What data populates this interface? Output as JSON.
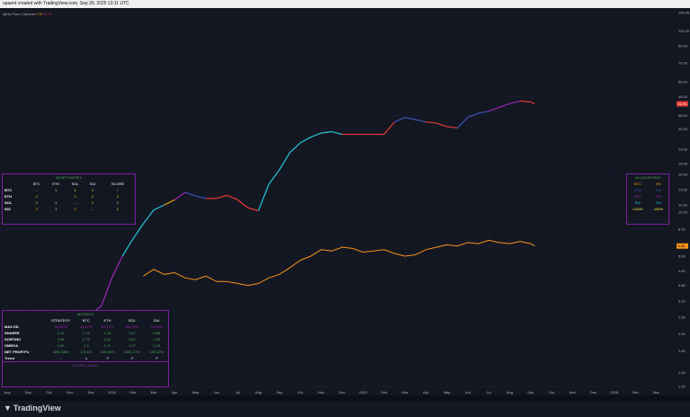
{
  "header": {
    "title": "opaent created with TradingView.com, Sep 29, 2025 13:11 UTC"
  },
  "legend": {
    "label": "Ajeto Flow | Opaent",
    "v1": "0.76",
    "v2": "41.91"
  },
  "price_tags": {
    "top": "41.91",
    "bottom": "6.40"
  },
  "footer": {
    "brand": "TradingView"
  },
  "asset_matrix": {
    "title": "ASSET MATRIX",
    "columns": [
      "",
      "BTC",
      "ETH",
      "SOL",
      "SUI",
      "SCORE"
    ],
    "rows": [
      {
        "label": "BTC",
        "cells": [
          "—",
          "1",
          "1",
          "1",
          "3"
        ]
      },
      {
        "label": "ETH",
        "cells": [
          "0",
          "—",
          "0",
          "0",
          "0"
        ]
      },
      {
        "label": "SOL",
        "cells": [
          "0",
          "1",
          "—",
          "0",
          "1"
        ]
      },
      {
        "label": "SUI",
        "cells": [
          "0",
          "1",
          "0",
          "—",
          "1"
        ]
      }
    ]
  },
  "allocations": {
    "title": "ALLOCATIONS",
    "rows": [
      {
        "label": "BTC",
        "value": "0%"
      },
      {
        "label": "ETH",
        "value": "0%"
      },
      {
        "label": "SOL",
        "value": "0%"
      },
      {
        "label": "SUI",
        "value": "0%"
      },
      {
        "label": "CASH",
        "value": "100%"
      }
    ]
  },
  "metrics": {
    "title": "METRICS",
    "columns": [
      "",
      "STRATEGY",
      "BTC",
      "ETH",
      "SOL",
      "SUI"
    ],
    "rows": [
      {
        "label": "MAX DD",
        "cells": [
          "32.82%",
          "26.17%",
          "63.77%",
          "58.79%",
          "76.24%"
        ]
      },
      {
        "label": "SHARPE",
        "cells": [
          "2.12",
          "1.72",
          "1.03",
          "1.67",
          "0.85"
        ]
      },
      {
        "label": "SORTINO",
        "cells": [
          "3.98",
          "2.75",
          "1.61",
          "3.07",
          "1.63"
        ]
      },
      {
        "label": "OMEGA",
        "cells": [
          "1.53",
          "1.3",
          "1.17",
          "1.27",
          "1.15"
        ]
      },
      {
        "label": "NET PROFIT%",
        "cells": [
          "4090.68%",
          "175.5%",
          "245.56%",
          "2051.27%",
          "133.22%"
        ]
      },
      {
        "label": "Trend",
        "cells": [
          "-",
          "↘",
          "↗",
          "↗",
          "↗"
        ]
      }
    ],
    "footer": "FILTER | Score"
  },
  "chart_data": {
    "type": "line",
    "y_scale": "log",
    "ylim": [
      1.0,
      140.0
    ],
    "yticks": [
      "140.00",
      "110.00",
      "90.00",
      "72.00",
      "56.00",
      "46.00",
      "36.00",
      "30.00",
      "23.00",
      "19.00",
      "16.50",
      "13.50",
      "11.00",
      "10.00",
      "8.00",
      "6.40",
      "5.60",
      "4.60",
      "3.80",
      "3.10",
      "2.50",
      "2.00",
      "1.60",
      "1.20",
      "1.00"
    ],
    "x_labels": [
      "Aug",
      "Sep",
      "Oct",
      "Nov",
      "Dec",
      "2024",
      "Feb",
      "Mar",
      "Apr",
      "May",
      "Jun",
      "Jul",
      "Aug",
      "Sep",
      "Oct",
      "Nov",
      "Dec",
      "2025",
      "Feb",
      "Mar",
      "Apr",
      "May",
      "Jun",
      "Jul",
      "Aug",
      "Sep",
      "Oct",
      "Nov",
      "Dec",
      "2026",
      "Feb",
      "Mar"
    ],
    "series": [
      {
        "kind": "equity",
        "x": [
          0,
          1,
          2,
          3,
          3.5,
          4,
          4.5,
          5,
          5.5,
          6,
          6.5,
          7,
          7.5,
          8,
          8.5,
          9,
          9.5,
          10,
          10.5,
          11,
          11.5,
          12,
          12.5,
          13,
          13.5,
          14,
          14.5,
          15,
          15.5,
          16,
          16.5,
          17,
          17.5,
          18,
          18.5,
          19,
          19.5,
          20,
          20.5,
          21,
          21.5,
          22,
          22.5,
          23,
          23.5,
          24,
          24.5,
          25,
          25.2
        ],
        "y": [
          1.0,
          1.1,
          1.3,
          1.8,
          2.1,
          2.6,
          2.9,
          4.2,
          5.6,
          7.0,
          8.6,
          10.3,
          11.0,
          11.8,
          13.0,
          12.4,
          12.0,
          12.0,
          12.5,
          11.8,
          10.6,
          10.2,
          14.5,
          17.5,
          22.0,
          25.0,
          27.0,
          28.5,
          29.0,
          28.0,
          28.0,
          28.0,
          28.0,
          28.0,
          33.0,
          35.0,
          34.0,
          33.0,
          32.5,
          31.0,
          30.5,
          35.0,
          37.0,
          38.0,
          40.0,
          42.0,
          43.5,
          43.0,
          41.9
        ]
      },
      {
        "kind": "benchmark",
        "x": [
          6.5,
          7,
          7.5,
          8,
          8.5,
          9,
          9.5,
          10,
          10.5,
          11,
          11.5,
          12,
          12.5,
          13,
          13.5,
          14,
          14.5,
          15,
          15.5,
          16,
          16.5,
          17,
          17.5,
          18,
          18.5,
          19,
          19.5,
          20,
          20.5,
          21,
          21.5,
          22,
          22.5,
          23,
          23.5,
          24,
          24.5,
          25,
          25.2
        ],
        "y": [
          4.3,
          4.7,
          4.4,
          4.5,
          4.2,
          4.1,
          4.3,
          4.0,
          4.0,
          3.9,
          3.8,
          3.9,
          4.2,
          4.4,
          4.8,
          5.3,
          5.6,
          6.1,
          6.0,
          6.3,
          6.2,
          5.9,
          6.0,
          6.1,
          5.8,
          5.6,
          5.7,
          6.1,
          6.3,
          6.5,
          6.4,
          6.7,
          6.6,
          6.9,
          6.7,
          6.6,
          6.8,
          6.6,
          6.4
        ]
      }
    ]
  }
}
